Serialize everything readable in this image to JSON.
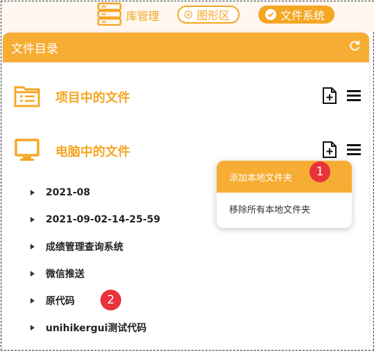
{
  "topbar": {
    "library_label": "库管理",
    "graph_label": "图形区",
    "filesystem_label": "文件系统"
  },
  "panel": {
    "title": "文件目录",
    "sections": [
      {
        "label": "项目中的文件"
      },
      {
        "label": "电脑中的文件"
      }
    ]
  },
  "tree": {
    "items": [
      {
        "label": "2021-08"
      },
      {
        "label": "2021-09-02-14-25-59"
      },
      {
        "label": "成绩管理查询系统"
      },
      {
        "label": "微信推送"
      },
      {
        "label": "原代码"
      },
      {
        "label": "unihikergui测试代码"
      }
    ]
  },
  "dropdown": {
    "items": [
      {
        "label": "添加本地文件夹"
      },
      {
        "label": "移除所有本地文件夹"
      }
    ]
  },
  "annotations": {
    "badge1": "1",
    "badge2": "2"
  },
  "colors": {
    "accent": "#f5a623",
    "header": "#f7ac33",
    "badge": "#e8323c"
  }
}
